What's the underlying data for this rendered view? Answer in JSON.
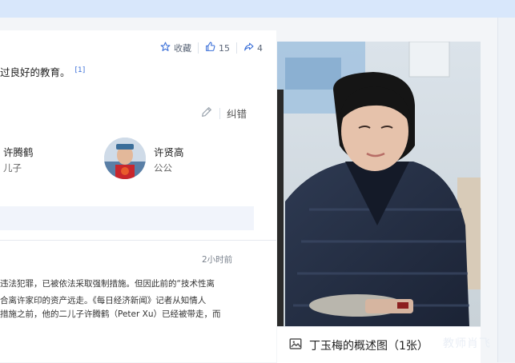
{
  "actions": {
    "favorite_label": "收藏",
    "like_count": "15",
    "share_count": "4"
  },
  "intro": {
    "text": "过良好的教育。",
    "ref": "[1]"
  },
  "correct_label": "纠错",
  "relations": [
    {
      "name": "许腾鹤",
      "relation": "儿子"
    },
    {
      "name": "许贤高",
      "relation": "公公"
    }
  ],
  "news": {
    "time": "2小时前",
    "lines": [
      "违法犯罪，已被依法采取强制措施。但因此前的“技术性离",
      "合离许家印的资产远走。《每日经济新闻》记者从知情人",
      "措施之前，他的二儿子许腾鹤（Peter Xu）已经被带走，而"
    ]
  },
  "photo": {
    "caption": "丁玉梅的概述图（1张）",
    "watermark": "教师肖飞"
  },
  "colors": {
    "accent": "#3a6fd8",
    "topbar": "#d8e7fb"
  }
}
